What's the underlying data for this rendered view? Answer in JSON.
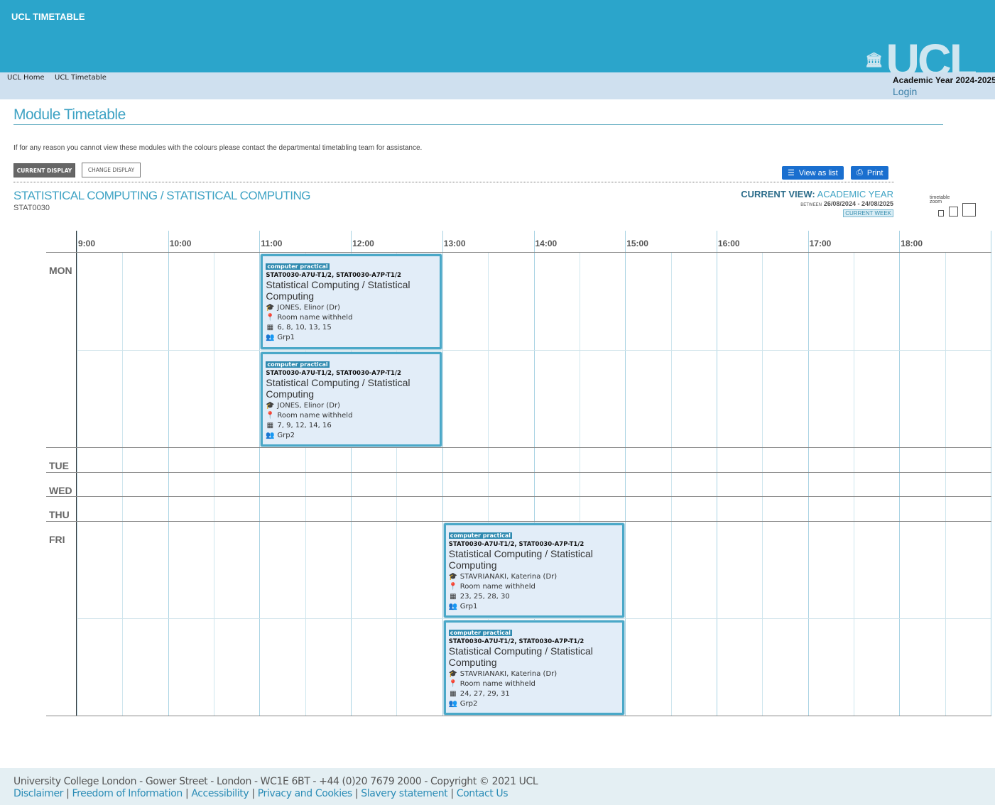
{
  "header": {
    "app_title": "UCL TIMETABLE",
    "logo_text": "UCL",
    "academic_year": "Academic Year 2024-2025",
    "login": "Login"
  },
  "breadcrumb": [
    "UCL Home",
    "UCL Timetable"
  ],
  "page": {
    "title": "Module Timetable",
    "notice": "If for any reason you cannot view these modules with the colours please contact the departmental timetabling team for assistance.",
    "current_display": "CURRENT DISPLAY",
    "change_display": "CHANGE DISPLAY",
    "view_as_list": "View as list",
    "print": "Print"
  },
  "module": {
    "title": "STATISTICAL COMPUTING / STATISTICAL COMPUTING",
    "code": "STAT0030"
  },
  "view": {
    "label": "CURRENT VIEW:",
    "value": "ACADEMIC YEAR",
    "between_label": "BETWEEN",
    "range": "26/08/2024 - 24/08/2025",
    "current_week": "CURRENT WEEK",
    "zoom_label": "timetable zoom"
  },
  "timetable": {
    "hours": [
      "9:00",
      "10:00",
      "11:00",
      "12:00",
      "13:00",
      "14:00",
      "15:00",
      "16:00",
      "17:00",
      "18:00"
    ],
    "days": [
      "MON",
      "TUE",
      "WED",
      "THU",
      "FRI"
    ],
    "events": [
      {
        "day": "MON",
        "slot": 0,
        "start": "11:00",
        "end": "13:00",
        "type": "computer practical",
        "codes": "STAT0030-A7U-T1/2, STAT0030-A7P-T1/2",
        "name": "Statistical Computing / Statistical Computing",
        "lecturer": "JONES, Elinor (Dr)",
        "room": "Room name withheld",
        "weeks": "6, 8, 10, 13, 15",
        "group": "Grp1"
      },
      {
        "day": "MON",
        "slot": 1,
        "start": "11:00",
        "end": "13:00",
        "type": "computer practical",
        "codes": "STAT0030-A7U-T1/2, STAT0030-A7P-T1/2",
        "name": "Statistical Computing / Statistical Computing",
        "lecturer": "JONES, Elinor (Dr)",
        "room": "Room name withheld",
        "weeks": "7, 9, 12, 14, 16",
        "group": "Grp2"
      },
      {
        "day": "FRI",
        "slot": 0,
        "start": "13:00",
        "end": "15:00",
        "type": "computer practical",
        "codes": "STAT0030-A7U-T1/2, STAT0030-A7P-T1/2",
        "name": "Statistical Computing / Statistical Computing",
        "lecturer": "STAVRIANAKI, Katerina (Dr)",
        "room": "Room name withheld",
        "weeks": "23, 25, 28, 30",
        "group": "Grp1"
      },
      {
        "day": "FRI",
        "slot": 1,
        "start": "13:00",
        "end": "15:00",
        "type": "computer practical",
        "codes": "STAT0030-A7U-T1/2, STAT0030-A7P-T1/2",
        "name": "Statistical Computing / Statistical Computing",
        "lecturer": "STAVRIANAKI, Katerina (Dr)",
        "room": "Room name withheld",
        "weeks": "24, 27, 29, 31",
        "group": "Grp2"
      }
    ]
  },
  "footer": {
    "address": "University College London - Gower Street - London - WC1E 6BT - +44 (0)20 7679 2000 - Copyright © 2021 UCL",
    "links": [
      "Disclaimer",
      "Freedom of Information",
      "Accessibility",
      "Privacy and Cookies",
      "Slavery statement",
      "Contact Us"
    ]
  }
}
